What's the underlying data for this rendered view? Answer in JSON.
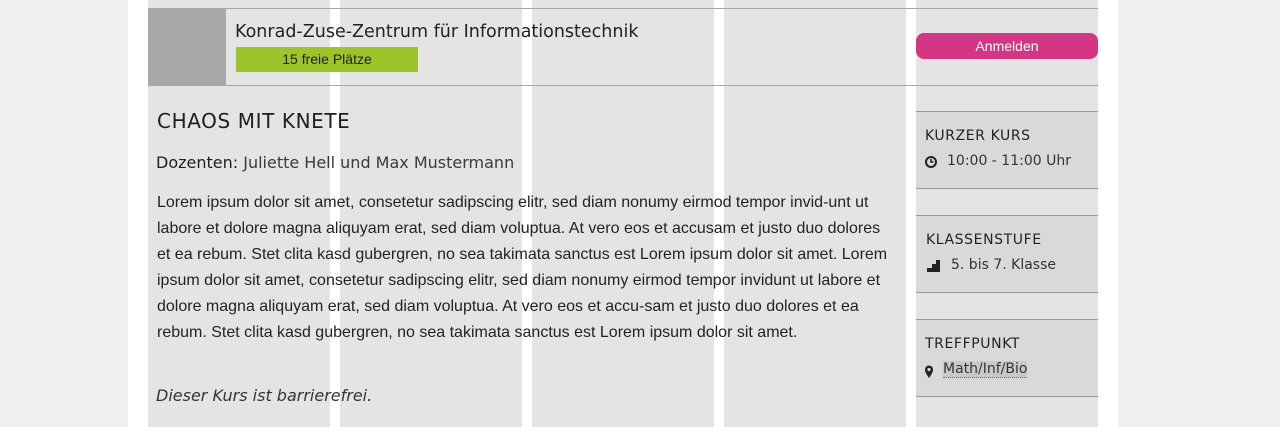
{
  "course": {
    "institution": "Konrad-Zuse-Zentrum für Informationstechnik",
    "seats": "15 freie Plätze",
    "register_label": "Anmelden",
    "title": "CHAOS MIT KNETE",
    "lecturers_label": "Dozenten:",
    "lecturers": "Juliette Hell und Max Mustermann",
    "description": "Lorem ipsum dolor sit amet, consetetur sadipscing elitr, sed diam nonumy eirmod tempor invid-unt ut labore et dolore magna aliquyam erat, sed diam voluptua. At vero eos et accusam et justo duo dolores et ea rebum. Stet clita kasd gubergren, no sea takimata sanctus est Lorem ipsum dolor sit amet. Lorem ipsum dolor sit amet, consetetur sadipscing elitr, sed diam nonumy eirmod tempor invidunt ut labore et dolore magna aliquyam erat, sed diam voluptua. At vero eos et accu-sam et justo duo dolores et ea rebum. Stet clita kasd gubergren, no sea takimata sanctus est Lorem ipsum dolor sit amet.",
    "accessibility": "Dieser Kurs ist barrierefrei."
  },
  "info": {
    "duration": {
      "heading": "KURZER KURS",
      "value": "10:00 - 11:00 Uhr",
      "icon": "clock-icon"
    },
    "grade": {
      "heading": "KLASSENSTUFE",
      "value": "5. bis 7. Klasse",
      "icon": "stairs-icon"
    },
    "location": {
      "heading": "TREFFPUNKT",
      "value": "Math/Inf/Bio",
      "icon": "map-pin-icon"
    }
  },
  "colors": {
    "accent_pink": "#d43684",
    "seats_green": "#9dc42a",
    "grid_gray": "#e4e4e4",
    "box_gray": "#d9d9d9"
  }
}
